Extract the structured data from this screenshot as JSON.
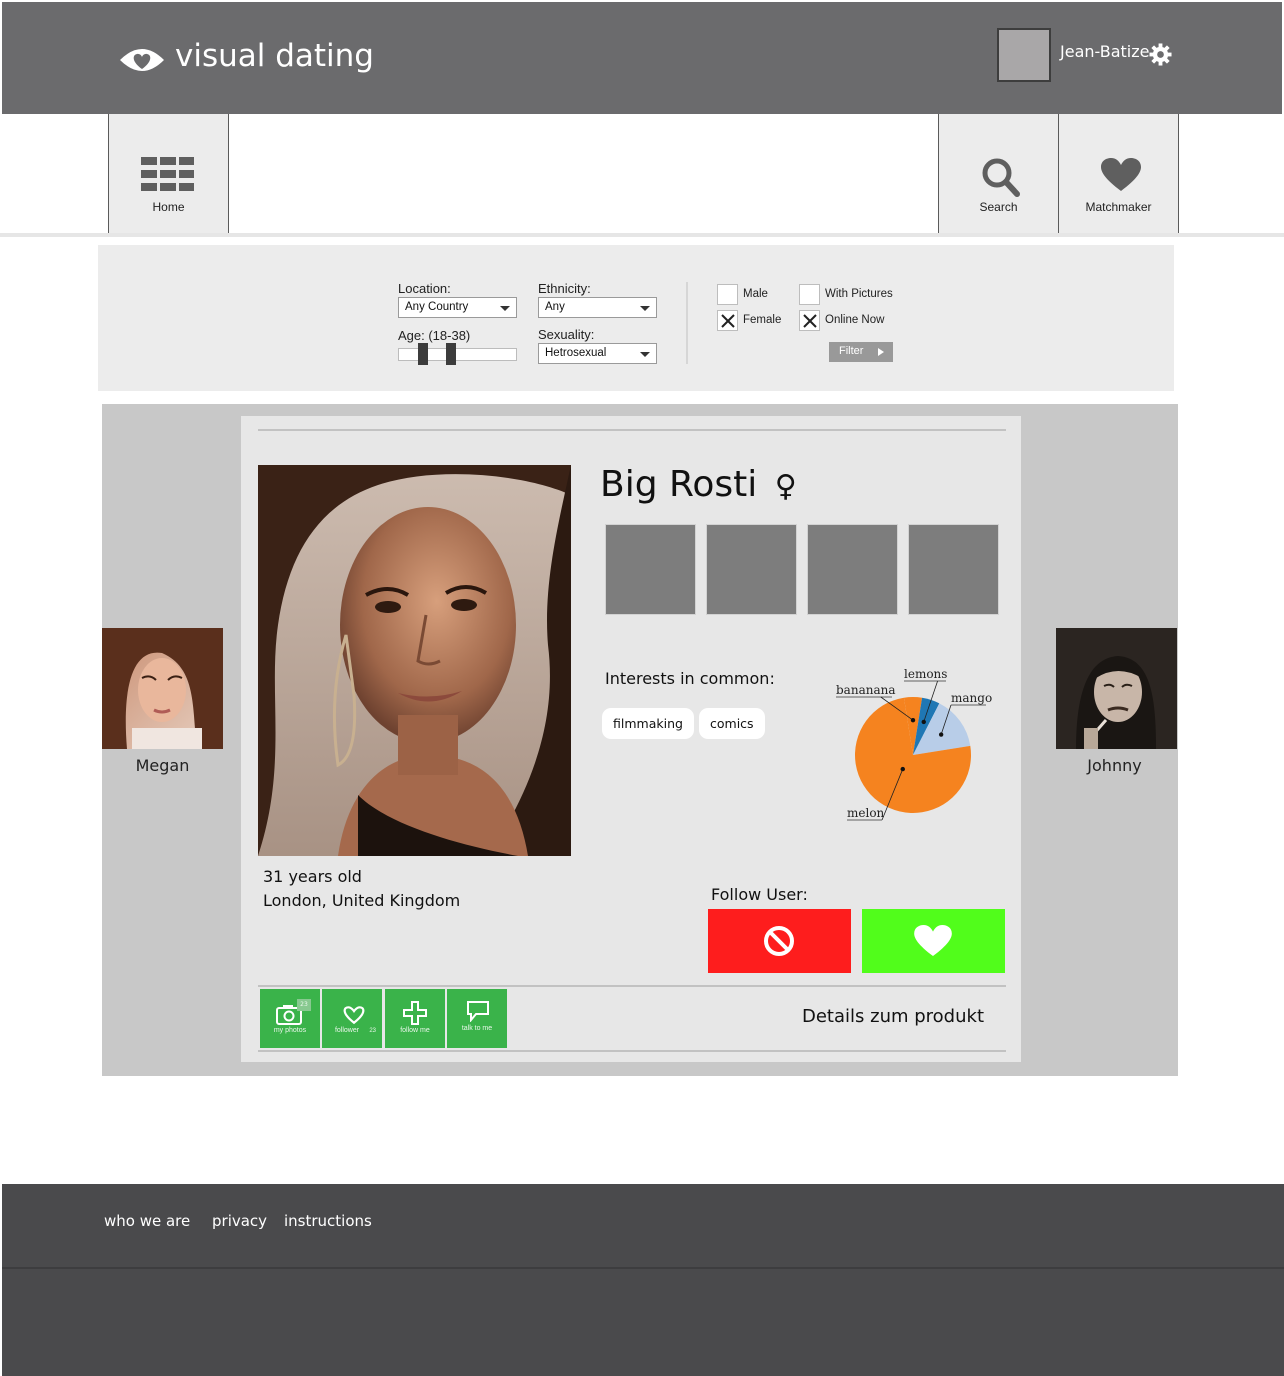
{
  "header": {
    "logo_text": "visual dating",
    "user_name": "Jean-Batize"
  },
  "nav": {
    "home": "Home",
    "search": "Search",
    "matchmaker": "Matchmaker"
  },
  "filters": {
    "location_label": "Location:",
    "location_value": "Any Country",
    "ethnicity_label": "Ethnicity:",
    "ethnicity_value": "Any",
    "age_label": "Age: (18-38)",
    "age_min": 18,
    "age_max": 38,
    "sexuality_label": "Sexuality:",
    "sexuality_value": "Hetrosexual",
    "male_label": "Male",
    "male_checked": false,
    "female_label": "Female",
    "female_checked": true,
    "pictures_label": "With Pictures",
    "pictures_checked": false,
    "online_label": "Online Now",
    "online_checked": true,
    "filter_button": "Filter"
  },
  "profile": {
    "name": "Big Rosti",
    "gender_symbol": "♀",
    "age_text": "31 years old",
    "location_text": "London, United Kingdom",
    "interests_title": "Interests in common:",
    "interests": [
      "filmmaking",
      "comics"
    ],
    "follow_label": "Follow User:",
    "details_text": "Details zum produkt"
  },
  "actions": {
    "my_photos": "my photos",
    "my_photos_count": "23",
    "follower": "follower",
    "follower_count": "23",
    "follow_me": "follow me",
    "talk_to_me": "talk to me"
  },
  "side": {
    "left_name": "Megan",
    "right_name": "Johnny"
  },
  "chart_data": {
    "type": "pie",
    "labels": [
      "melon",
      "bananana",
      "lemons",
      "mango"
    ],
    "values": [
      75,
      5,
      5,
      15
    ],
    "colors": [
      "#f5831f",
      "#f5831f",
      "#1f77b4",
      "#b8cde8"
    ]
  },
  "footer": {
    "links": [
      "who we are",
      "privacy",
      "instructions"
    ]
  },
  "colors": {
    "header_bg": "#6b6b6d",
    "footer_bg": "#4a4a4c",
    "block": "#fe1d1d",
    "like": "#51fd1b",
    "action_green": "#3ab34a"
  }
}
